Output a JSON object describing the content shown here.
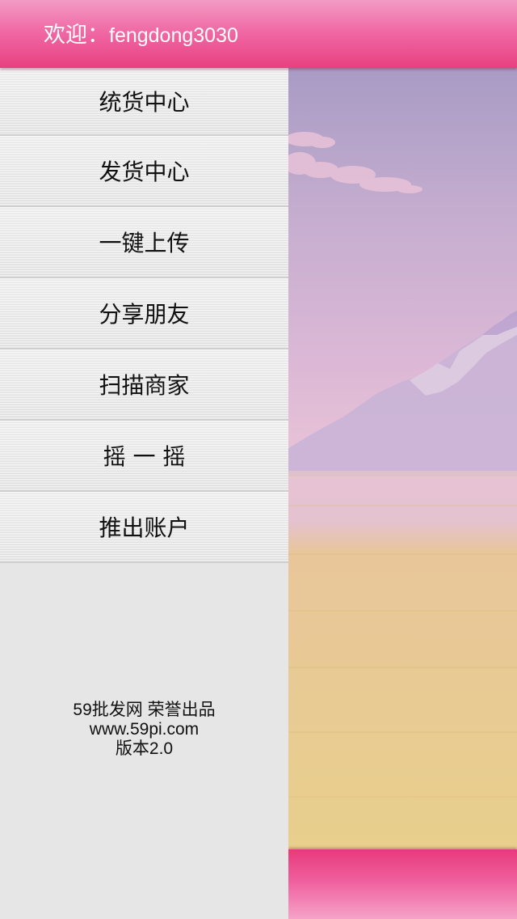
{
  "header": {
    "welcome_prefix": "欢迎：",
    "username": "fengdong3030"
  },
  "menu": {
    "items": [
      {
        "label": "统货中心"
      },
      {
        "label": "发货中心"
      },
      {
        "label": "一键上传"
      },
      {
        "label": "分享朋友"
      },
      {
        "label": "扫描商家"
      },
      {
        "label": "摇 一 摇"
      },
      {
        "label": "推出账户"
      }
    ]
  },
  "footer": {
    "credit": "59批发网 荣誉出品",
    "website": "www.59pi.com",
    "version": "版本2.0"
  },
  "colors": {
    "accent": "#ef5f9d",
    "sidebar_bg": "#e6e6e6"
  }
}
